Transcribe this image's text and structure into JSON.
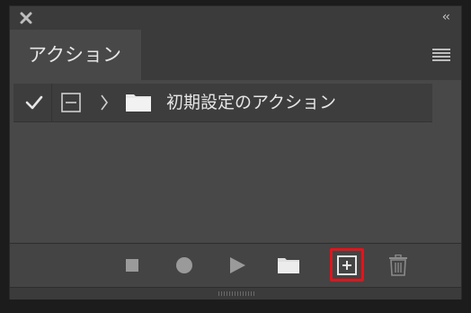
{
  "titlebar": {
    "close_icon": "close-icon",
    "collapse_label": "‹‹"
  },
  "tabs": [
    {
      "label": "アクション"
    }
  ],
  "panel_menu_icon": "hamburger-menu-icon",
  "actions_list": [
    {
      "checked": true,
      "check_icon": "checkmark-icon",
      "dialog_icon": "dialog-toggle-icon",
      "expand_icon": "chevron-right-icon",
      "folder_icon": "folder-icon",
      "label": "初期設定のアクション"
    }
  ],
  "toolbar": {
    "stop_icon": "stop-icon",
    "record_icon": "record-icon",
    "play_icon": "play-icon",
    "new_set_icon": "folder-icon",
    "new_action_icon": "new-action-icon",
    "delete_icon": "trash-icon",
    "highlighted": "new-action-button",
    "highlight_color": "#e3141b"
  },
  "colors": {
    "panel_bg": "#484848",
    "titlebar_bg": "#3b3b3b",
    "row_bg": "#3d3d3d",
    "text": "#e6e6e6"
  }
}
